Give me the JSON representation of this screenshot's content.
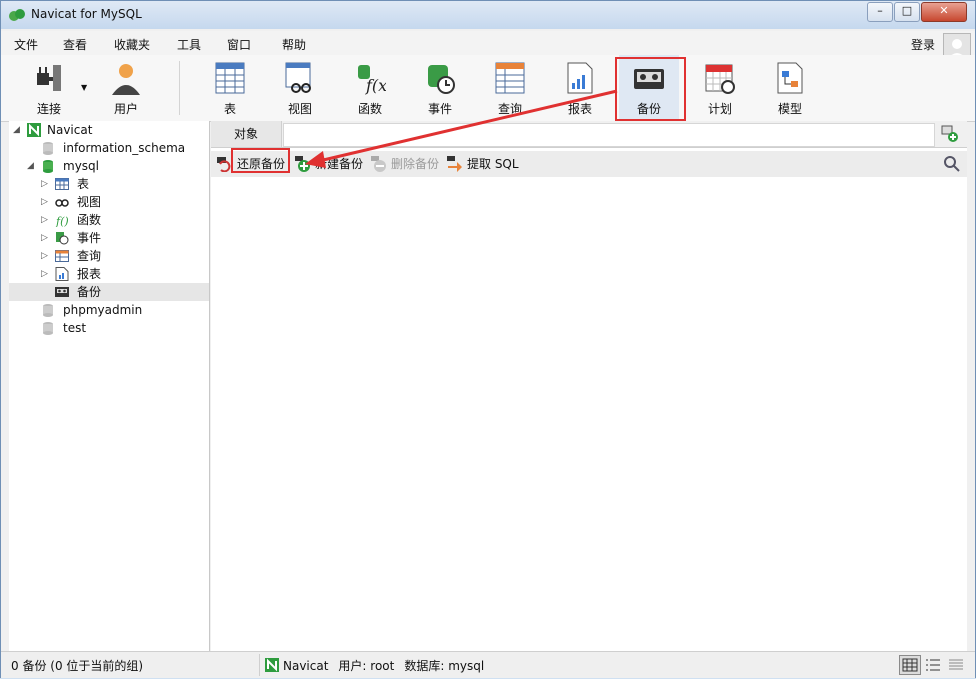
{
  "window": {
    "title": "Navicat for MySQL"
  },
  "menu": {
    "items": [
      "文件",
      "查看",
      "收藏夹",
      "工具",
      "窗口",
      "帮助"
    ],
    "login": "登录"
  },
  "toolbar": {
    "connect": "连接",
    "user": "用户",
    "table": "表",
    "view": "视图",
    "function": "函数",
    "event": "事件",
    "query": "查询",
    "report": "报表",
    "backup": "备份",
    "schedule": "计划",
    "model": "模型"
  },
  "sidebar": {
    "root": "Navicat",
    "db1": "information_schema",
    "db2": "mysql",
    "children": [
      "表",
      "视图",
      "函数",
      "事件",
      "查询",
      "报表",
      "备份"
    ],
    "db3": "phpmyadmin",
    "db4": "test"
  },
  "main": {
    "tab": "对象",
    "actions": {
      "restore": "还原备份",
      "new": "新建备份",
      "delete": "删除备份",
      "extract": "提取 SQL"
    }
  },
  "status": {
    "left": "0 备份 (0 位于当前的组)",
    "connection": "Navicat",
    "user": "用户: root",
    "database": "数据库: mysql"
  },
  "colors": {
    "highlight": "#e03131",
    "accent_green": "#2e9c3e"
  }
}
